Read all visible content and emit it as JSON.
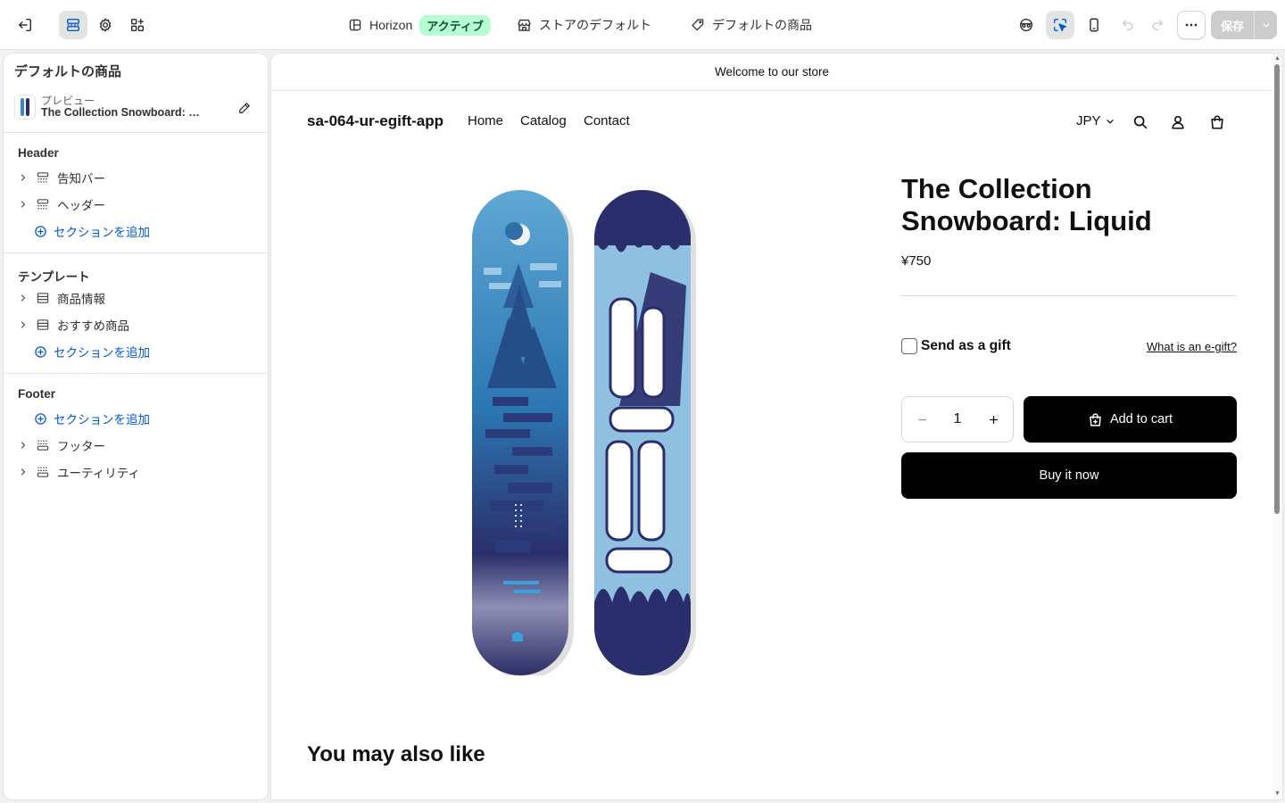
{
  "topbar": {
    "theme_name": "Horizon",
    "theme_badge": "アクティブ",
    "store_default": "ストアのデフォルト",
    "product_default": "デフォルトの商品",
    "save_label": "保存"
  },
  "sidebar": {
    "title": "デフォルトの商品",
    "preview_label": "プレビュー",
    "preview_product": "The Collection Snowboard: Liquid",
    "add_section": "セクションを追加",
    "groups": [
      {
        "title": "Header",
        "items": [
          "告知バー",
          "ヘッダー"
        ]
      },
      {
        "title": "テンプレート",
        "items": [
          "商品情報",
          "おすすめ商品"
        ]
      },
      {
        "title": "Footer",
        "items": [
          "フッター",
          "ユーティリティ"
        ]
      }
    ]
  },
  "store": {
    "announcement": "Welcome to our store",
    "name": "sa-064-ur-egift-app",
    "nav": [
      "Home",
      "Catalog",
      "Contact"
    ],
    "currency": "JPY",
    "product": {
      "title": "The Collection Snowboard: Liquid",
      "price": "¥750",
      "gift_label": "Send as a gift",
      "gift_link": "What is an e-gift?",
      "quantity": "1",
      "add_to_cart": "Add to cart",
      "buy_now": "Buy it now"
    },
    "recommendations_title": "You may also like"
  },
  "colors": {
    "accent": "#005bd3",
    "badge_bg": "#b4fed2",
    "badge_text": "#0c5132",
    "button_bg": "#000000"
  },
  "icons": {
    "exit": "exit-icon",
    "sections": "sections-icon",
    "settings": "gear-icon",
    "apps": "apps-icon",
    "inspector": "inspector-icon",
    "mobile": "mobile-icon",
    "undo": "undo-icon",
    "redo": "redo-icon",
    "more": "more-icon"
  }
}
